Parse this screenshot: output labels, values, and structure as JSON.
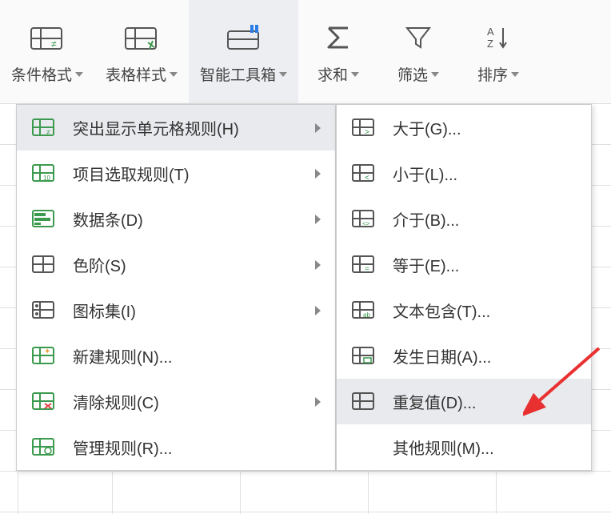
{
  "toolbar": {
    "items": [
      {
        "label": "条件格式",
        "icon": "conditional-format"
      },
      {
        "label": "表格样式",
        "icon": "table-style"
      },
      {
        "label": "智能工具箱",
        "icon": "smart-toolbox",
        "highlight": true
      },
      {
        "label": "求和",
        "icon": "sum"
      },
      {
        "label": "筛选",
        "icon": "filter"
      },
      {
        "label": "排序",
        "icon": "sort"
      }
    ]
  },
  "menu1": {
    "items": [
      {
        "label": "突出显示单元格规则(H)",
        "icon": "highlight-cells",
        "hasSub": true,
        "hover": true
      },
      {
        "label": "项目选取规则(T)",
        "icon": "top-bottom",
        "hasSub": true
      },
      {
        "label": "数据条(D)",
        "icon": "data-bars",
        "hasSub": true
      },
      {
        "label": "色阶(S)",
        "icon": "color-scale",
        "hasSub": true
      },
      {
        "label": "图标集(I)",
        "icon": "icon-set",
        "hasSub": true
      },
      {
        "label": "新建规则(N)...",
        "icon": "new-rule"
      },
      {
        "label": "清除规则(C)",
        "icon": "clear-rule",
        "hasSub": true
      },
      {
        "label": "管理规则(R)...",
        "icon": "manage-rule"
      }
    ]
  },
  "menu2": {
    "items": [
      {
        "label": "大于(G)...",
        "icon": "greater"
      },
      {
        "label": "小于(L)...",
        "icon": "less"
      },
      {
        "label": "介于(B)...",
        "icon": "between"
      },
      {
        "label": "等于(E)...",
        "icon": "equal"
      },
      {
        "label": "文本包含(T)...",
        "icon": "text-contains"
      },
      {
        "label": "发生日期(A)...",
        "icon": "date-occurring"
      },
      {
        "label": "重复值(D)...",
        "icon": "duplicate",
        "hover": true
      },
      {
        "label": "其他规则(M)...",
        "icon": "none"
      }
    ]
  }
}
